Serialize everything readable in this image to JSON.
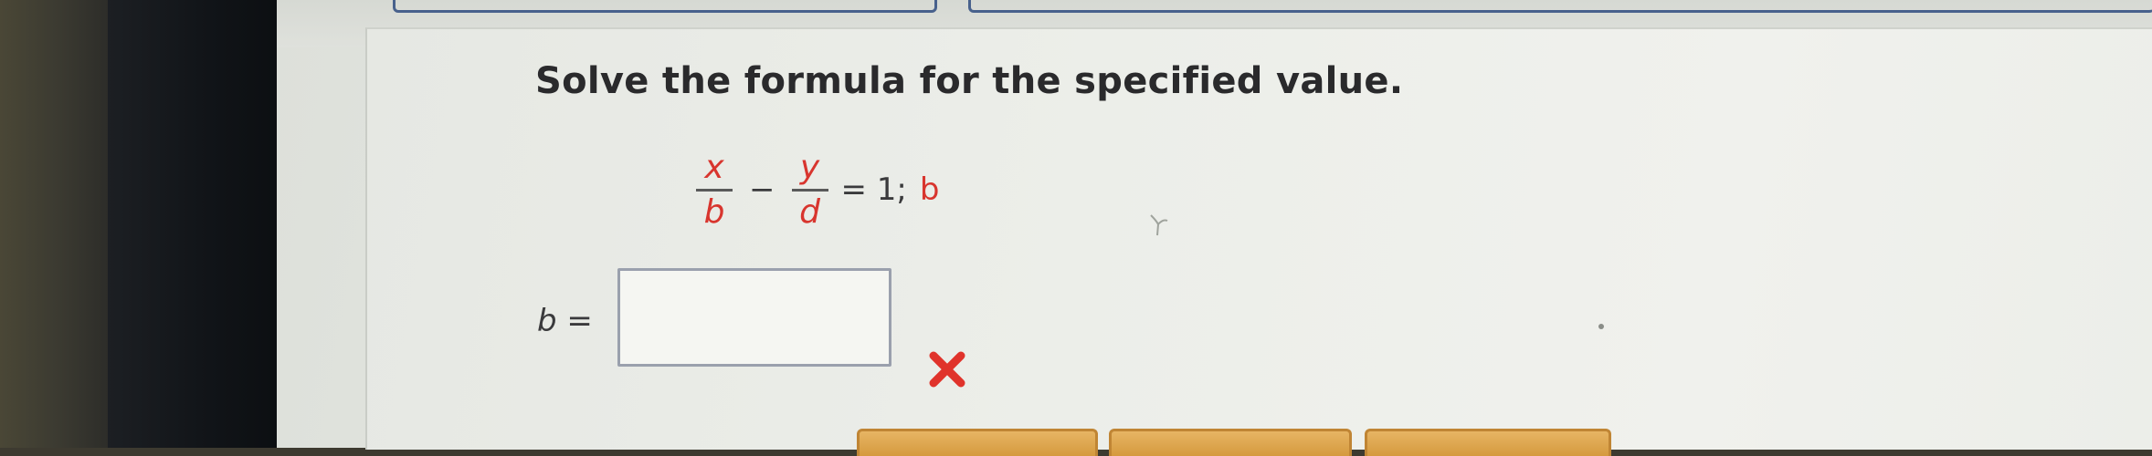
{
  "problem": {
    "instruction": "Solve the formula for the specified value.",
    "equation": {
      "term1": {
        "numerator": "x",
        "denominator": "b"
      },
      "operator": "−",
      "term2": {
        "numerator": "y",
        "denominator": "d"
      },
      "rhs": "= 1;",
      "solve_for": "b"
    }
  },
  "answer": {
    "variable": "b",
    "equals": "=",
    "value": "",
    "placeholder": "",
    "status": "incorrect",
    "status_icon": "red-x-icon"
  },
  "colors": {
    "variable_red": "#d8352e",
    "text_dark": "#2a2a2c",
    "input_border": "#9aa0ad",
    "tab_border": "#48618c",
    "button_orange": "#d59a3e"
  }
}
